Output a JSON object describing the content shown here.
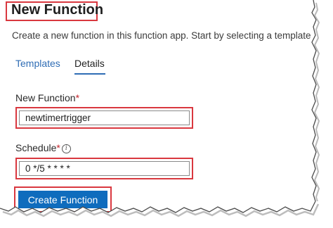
{
  "dialog": {
    "title": "New Function",
    "subtitle": "Create a new function in this function app. Start by selecting a template belo"
  },
  "tabs": [
    {
      "label": "Templates",
      "selected": false
    },
    {
      "label": "Details",
      "selected": true
    }
  ],
  "form": {
    "function_name": {
      "label": "New Function",
      "required_marker": "*",
      "value": "newtimertrigger"
    },
    "schedule": {
      "label": "Schedule",
      "required_marker": "*",
      "info_icon": "info-icon",
      "info_glyph": "i",
      "value": "0 */5 * * * *"
    }
  },
  "actions": {
    "create_label": "Create Function"
  },
  "colors": {
    "highlight_border": "#d9383f",
    "primary_button": "#0f6cbd",
    "tab_active_underline": "#2f6db5",
    "tab_inactive_text": "#2f6db5"
  }
}
